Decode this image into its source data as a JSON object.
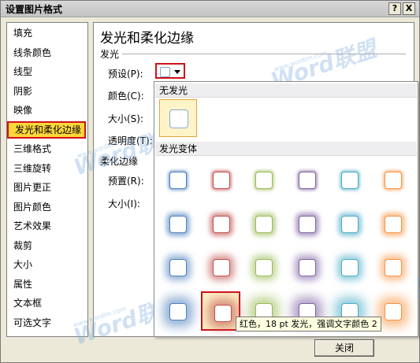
{
  "window": {
    "title": "设置图片格式",
    "help": "?",
    "close_x": "X"
  },
  "sidebar": {
    "items": [
      {
        "label": "填充"
      },
      {
        "label": "线条颜色"
      },
      {
        "label": "线型"
      },
      {
        "label": "阴影"
      },
      {
        "label": "映像"
      },
      {
        "label": "发光和柔化边缘"
      },
      {
        "label": "三维格式"
      },
      {
        "label": "三维旋转"
      },
      {
        "label": "图片更正"
      },
      {
        "label": "图片颜色"
      },
      {
        "label": "艺术效果"
      },
      {
        "label": "裁剪"
      },
      {
        "label": "大小"
      },
      {
        "label": "属性"
      },
      {
        "label": "文本框"
      },
      {
        "label": "可选文字"
      }
    ],
    "selected": 5
  },
  "panel": {
    "title": "发光和柔化边缘",
    "glow_section": "发光",
    "preset_label": "预设(P):",
    "color_label": "颜色(C):",
    "size_label": "大小(S):",
    "transparency_label": "透明度(T):",
    "soft_section": "柔化边缘",
    "soft_preset_label": "预置(R):",
    "soft_size_label": "大小(I):"
  },
  "gallery": {
    "no_glow_header": "无发光",
    "variants_header": "发光变体",
    "colors": [
      "#4f81bd",
      "#c0504d",
      "#9bbb59",
      "#8064a2",
      "#4bacc6",
      "#f79646"
    ],
    "selected_row": 3,
    "selected_col": 1
  },
  "tooltip": "红色，18 pt 发光，强调文字颜色 2",
  "close_button": "关闭",
  "watermark": {
    "text": "Word联盟",
    "url": "www.wordlm.com"
  }
}
